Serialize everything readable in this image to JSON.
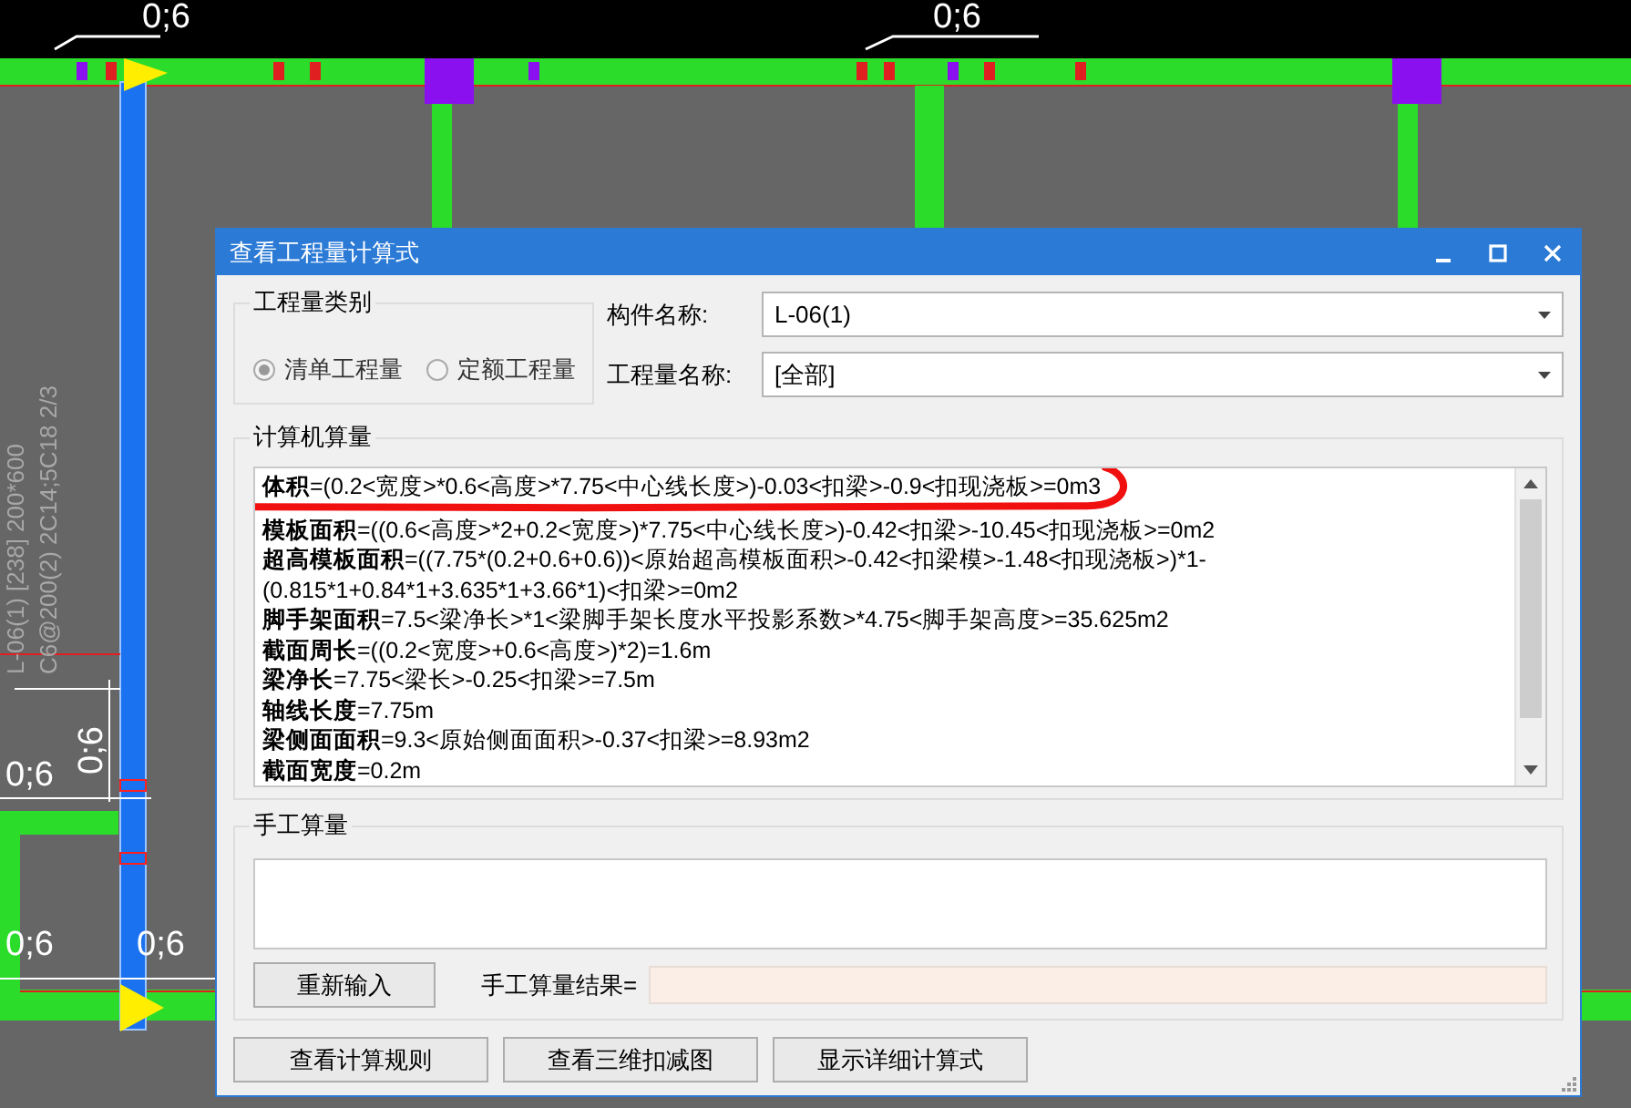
{
  "drawing": {
    "dimension_labels": [
      {
        "text": "0;6",
        "kind": "horizontal"
      },
      {
        "text": "0;6",
        "kind": "horizontal"
      },
      {
        "text": "0;6",
        "kind": "vertical"
      },
      {
        "text": "0;6",
        "kind": "horizontal"
      },
      {
        "text": "0;6",
        "kind": "horizontal"
      },
      {
        "text": "0;6",
        "kind": "horizontal"
      }
    ],
    "beam_labels": [
      "L-06(1) [238] 200*600",
      "C6@200(2) 2C14;5C18 2/3"
    ]
  },
  "window": {
    "title": "查看工程量计算式"
  },
  "category": {
    "legend": "工程量类别",
    "options": [
      {
        "label": "清单工程量",
        "selected": true
      },
      {
        "label": "定额工程量",
        "selected": false
      }
    ]
  },
  "fields": [
    {
      "label": "构件名称:",
      "value": "L-06(1)"
    },
    {
      "label": "工程量名称:",
      "value": "[全部]"
    }
  ],
  "computed": {
    "legend": "计算机算量",
    "lines": [
      "**体积**=(0.2<宽度>*0.6<高度>*7.75<中心线长度>)-0.03<扣梁>-0.9<扣现浇板>=0m3",
      "**模板面积**=((0.6<高度>*2+0.2<宽度>)*7.75<中心线长度>)-0.42<扣梁>-10.45<扣现浇板>=0m2",
      "**超高模板面积**=((7.75*(0.2+0.6+0.6))<原始超高模板面积>-0.42<扣梁模>-1.48<扣现浇板>)*1-(0.815*1+0.84*1+3.635*1+3.66*1)<扣梁>=0m2",
      "**脚手架面积**=7.5<梁净长>*1<梁脚手架长度水平投影系数>*4.75<脚手架高度>=35.625m2",
      "**截面周长**=((0.2<宽度>+0.6<高度>)*2)=1.6m",
      "**梁净长**=7.75<梁长>-0.25<扣梁>=7.5m",
      "**轴线长度**=7.75m",
      "**梁侧面面积**=9.3<原始侧面面积>-0.37<扣梁>=8.93m2",
      "**截面宽度**=0.2m"
    ]
  },
  "manual": {
    "legend": "手工算量",
    "reset_button": "重新输入",
    "result_label": "手工算量结果="
  },
  "buttons": [
    "查看计算规则",
    "查看三维扣减图",
    "显示详细计算式"
  ]
}
